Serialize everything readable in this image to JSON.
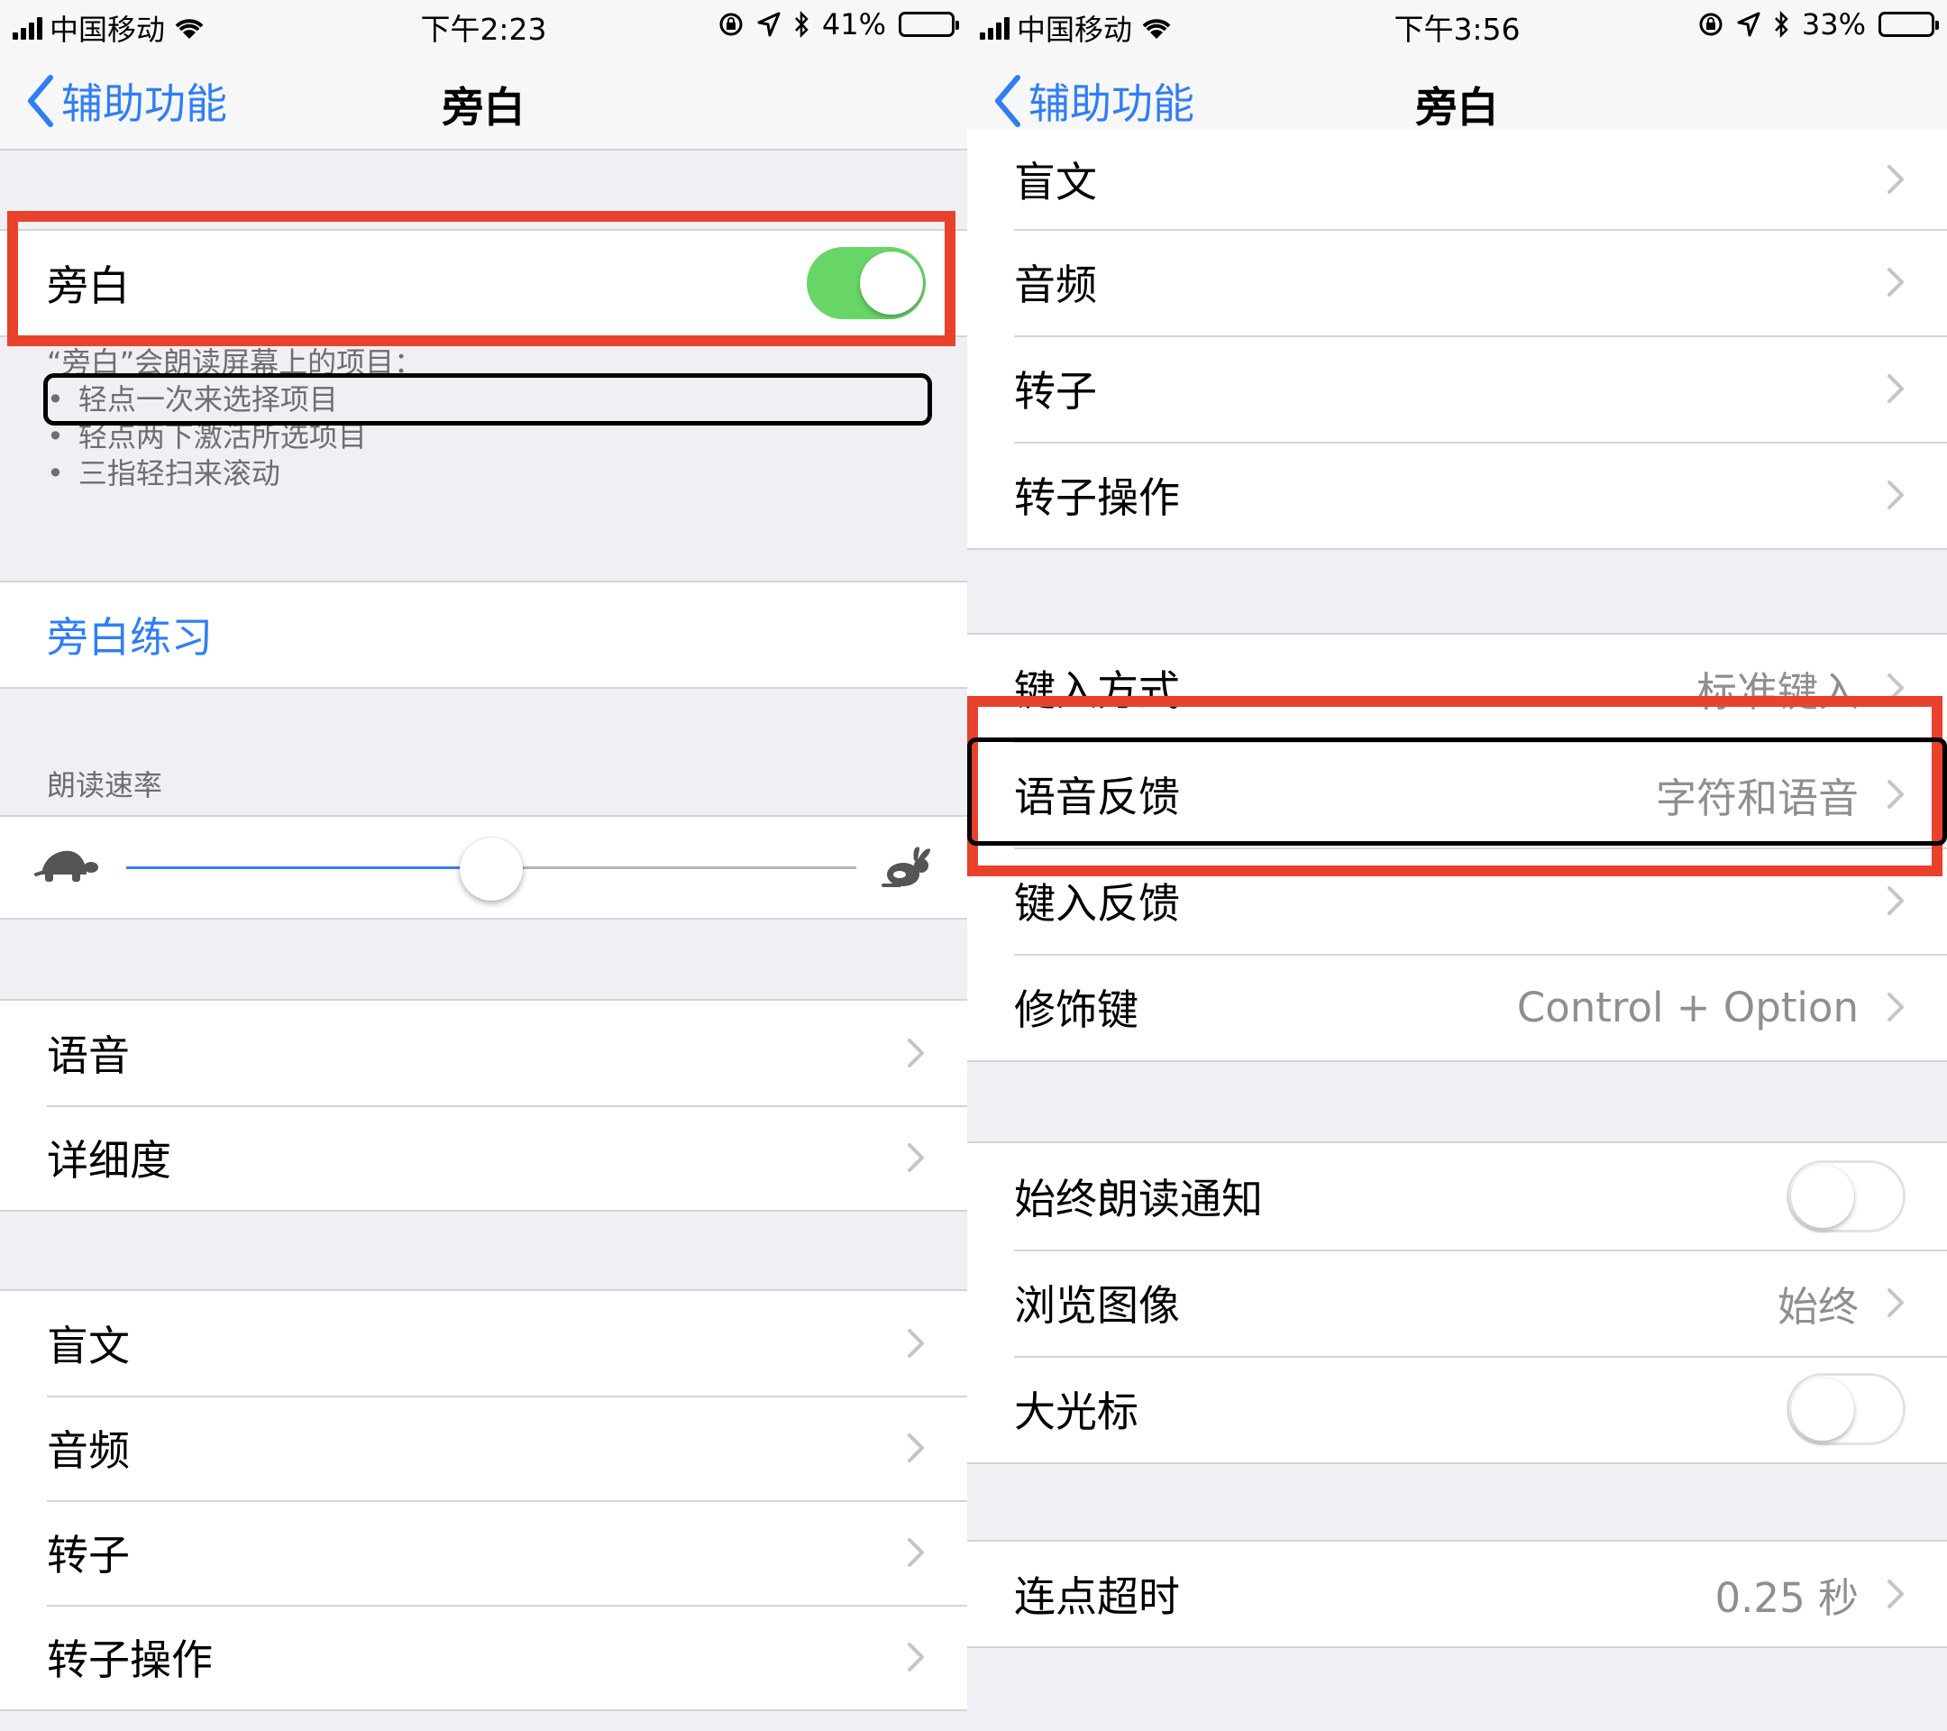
{
  "left": {
    "status": {
      "carrier": "中国移动",
      "time": "下午2:23",
      "battery": "41%",
      "battery_level": 0.41
    },
    "nav": {
      "back_label": "辅助功能",
      "title": "旁白"
    },
    "voiceover_cell": {
      "label": "旁白",
      "on": true
    },
    "footer": {
      "intro": "“旁白”会朗读屏幕上的项目：",
      "bullets": [
        "轻点一次来选择项目",
        "轻点两下激活所选项目",
        "三指轻扫来滚动"
      ]
    },
    "practice": "旁白练习",
    "rate_header": "朗读速率",
    "rate_value": 0.5,
    "group_speech": [
      "语音",
      "详细度"
    ],
    "group_braille": [
      "盲文",
      "音频",
      "转子",
      "转子操作"
    ]
  },
  "right": {
    "status": {
      "carrier": "中国移动",
      "time": "下午3:56",
      "battery": "33%",
      "battery_level": 0.33
    },
    "nav": {
      "back_label": "辅助功能",
      "title": "旁白"
    },
    "group_top": [
      "盲文",
      "音频",
      "转子",
      "转子操作"
    ],
    "group_typing": [
      {
        "label": "键入方式",
        "value": "标准键入"
      },
      {
        "label": "语音反馈",
        "value": "字符和语音"
      },
      {
        "label": "键入反馈",
        "value": ""
      },
      {
        "label": "修饰键",
        "value": "Control + Option"
      }
    ],
    "group_misc": {
      "notifications": {
        "label": "始终朗读通知",
        "on": false
      },
      "navigate_images": {
        "label": "浏览图像",
        "value": "始终"
      },
      "large_cursor": {
        "label": "大光标",
        "on": false
      }
    },
    "double_tap": {
      "label": "连点超时",
      "value": "0.25 秒"
    }
  },
  "colors": {
    "ios_blue": "#2f7ef6",
    "toggle_green": "#68d667",
    "highlight_red": "#e8412c"
  }
}
